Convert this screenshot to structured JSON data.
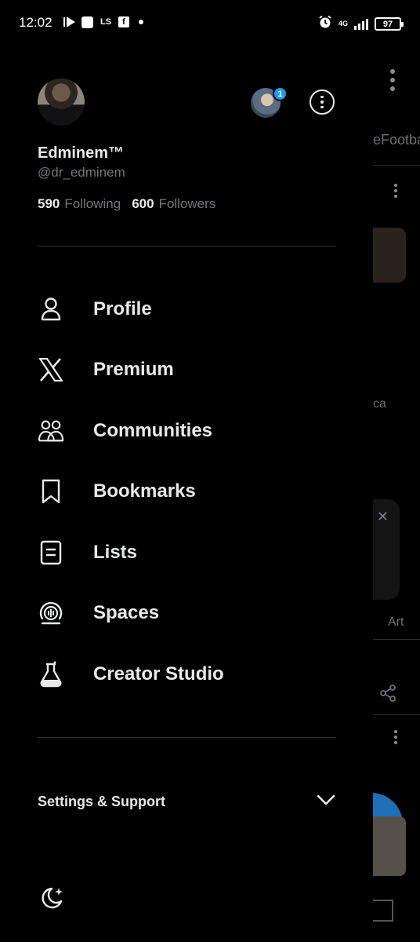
{
  "status_bar": {
    "time": "12:02",
    "left_icons": [
      "media-play-icon",
      "square-app-icon",
      "ls-app-icon",
      "facebook-icon"
    ],
    "ls_text": "LS",
    "fb_text": "f",
    "network": "4G",
    "battery": "97"
  },
  "profile": {
    "display_name": "Edminem™",
    "handle": "@dr_edminem",
    "following_count": "590",
    "following_label": "Following",
    "followers_count": "600",
    "followers_label": "Followers",
    "account_badge_count": "1"
  },
  "menu": {
    "items": [
      {
        "label": "Profile",
        "icon": "person-icon"
      },
      {
        "label": "Premium",
        "icon": "x-logo-icon"
      },
      {
        "label": "Communities",
        "icon": "communities-icon"
      },
      {
        "label": "Bookmarks",
        "icon": "bookmark-icon"
      },
      {
        "label": "Lists",
        "icon": "list-icon"
      },
      {
        "label": "Spaces",
        "icon": "spaces-icon"
      },
      {
        "label": "Creator Studio",
        "icon": "flask-icon"
      }
    ]
  },
  "settings": {
    "label": "Settings & Support"
  },
  "background": {
    "tab_fragment": "eFootba",
    "text_fragment_1": "ca",
    "text_fragment_2": "Art"
  },
  "colors": {
    "background": "#000000",
    "text_primary": "#e7e9ea",
    "text_secondary": "#71767b",
    "divider": "#2f3336",
    "accent": "#1d9bf0"
  }
}
